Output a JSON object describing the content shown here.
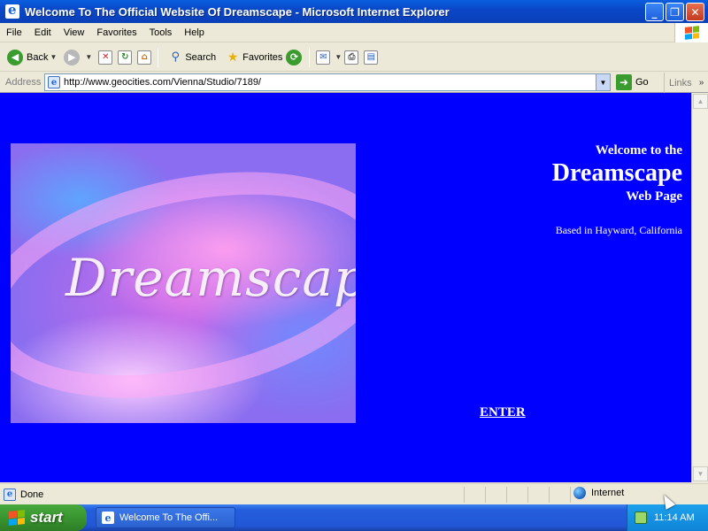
{
  "window": {
    "title": "Welcome To The Official Website Of Dreamscape - Microsoft Internet Explorer",
    "minimize": "_",
    "maximize": "❐",
    "close": "✕"
  },
  "menu": [
    "File",
    "Edit",
    "View",
    "Favorites",
    "Tools",
    "Help"
  ],
  "toolbar": {
    "back_label": "Back",
    "search_label": "Search",
    "favorites_label": "Favorites"
  },
  "address": {
    "label": "Address",
    "url": "http://www.geocities.com/Vienna/Studio/7189/",
    "go_label": "Go",
    "links_label": "Links"
  },
  "page": {
    "banner_text": "Dreamscape",
    "welcome_line1": "Welcome to the",
    "welcome_line2": "Dreamscape",
    "welcome_line3": "Web Page",
    "location": "Based in Hayward, California",
    "enter_label": "ENTER",
    "background_color": "#0000ff"
  },
  "status": {
    "text": "Done",
    "zone": "Internet"
  },
  "taskbar": {
    "start_label": "start",
    "task_label": "Welcome To The Offi...",
    "clock": "11:14 AM"
  },
  "colors": {
    "titlebar": "#0a48c8",
    "start_button": "#3c9a32",
    "taskbar": "#245edc"
  }
}
